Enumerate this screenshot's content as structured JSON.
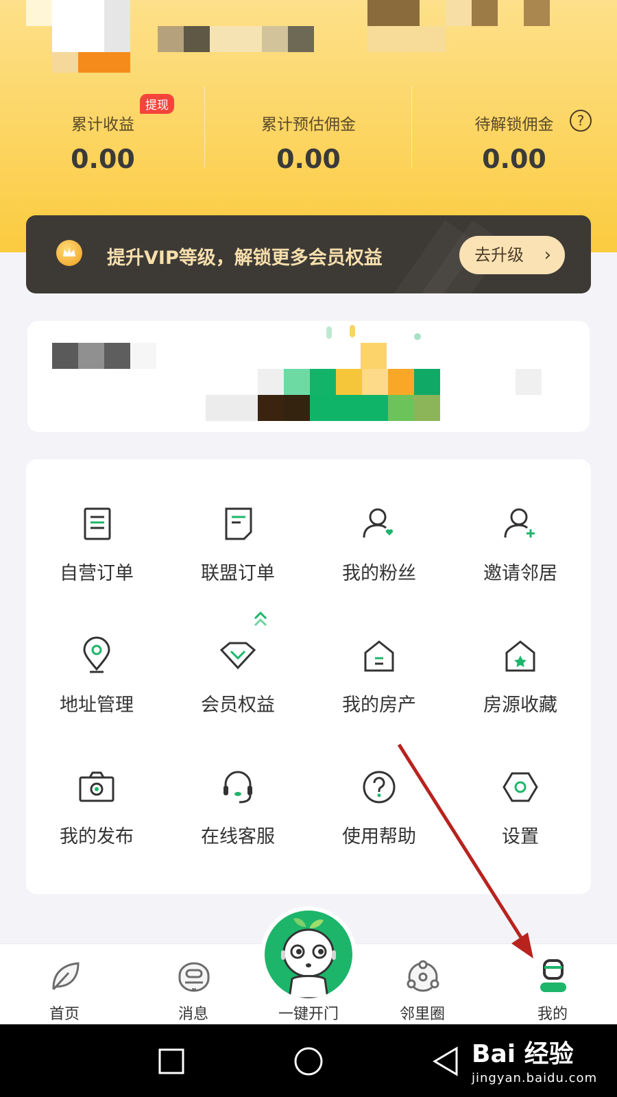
{
  "stats": [
    {
      "label": "累计收益",
      "value": "0.00"
    },
    {
      "label": "累计预估佣金",
      "value": "0.00"
    },
    {
      "label": "待解锁佣金",
      "value": "0.00"
    }
  ],
  "withdraw_badge": "提现",
  "help_symbol": "?",
  "vip": {
    "text": "提升VIP等级，解锁更多会员权益",
    "button": "去升级",
    "chevron": "›"
  },
  "menu": [
    {
      "label": "自营订单",
      "icon": "self-order-icon"
    },
    {
      "label": "联盟订单",
      "icon": "alliance-order-icon"
    },
    {
      "label": "我的粉丝",
      "icon": "fans-icon"
    },
    {
      "label": "邀请邻居",
      "icon": "invite-neighbor-icon"
    },
    {
      "label": "地址管理",
      "icon": "location-icon"
    },
    {
      "label": "会员权益",
      "icon": "diamond-icon"
    },
    {
      "label": "我的房产",
      "icon": "house-icon"
    },
    {
      "label": "房源收藏",
      "icon": "house-star-icon"
    },
    {
      "label": "我的发布",
      "icon": "camera-icon"
    },
    {
      "label": "在线客服",
      "icon": "headset-icon"
    },
    {
      "label": "使用帮助",
      "icon": "help-icon"
    },
    {
      "label": "设置",
      "icon": "settings-icon"
    }
  ],
  "tabs": [
    {
      "label": "首页",
      "icon": "leaf-icon"
    },
    {
      "label": "消息",
      "icon": "message-icon"
    },
    {
      "label": "一键开门",
      "icon": "robot-door-icon"
    },
    {
      "label": "邻里圈",
      "icon": "neighborhood-icon"
    },
    {
      "label": "我的",
      "icon": "profile-icon",
      "active": true
    }
  ],
  "watermark": {
    "brand": "Bai 经验",
    "url": "jingyan.baidu.com"
  },
  "colors": {
    "accent_green": "#1db56a",
    "header_yellow": "#fbcb3f",
    "vip_dark": "#3d3a36",
    "annotation_red": "#b8231e"
  }
}
